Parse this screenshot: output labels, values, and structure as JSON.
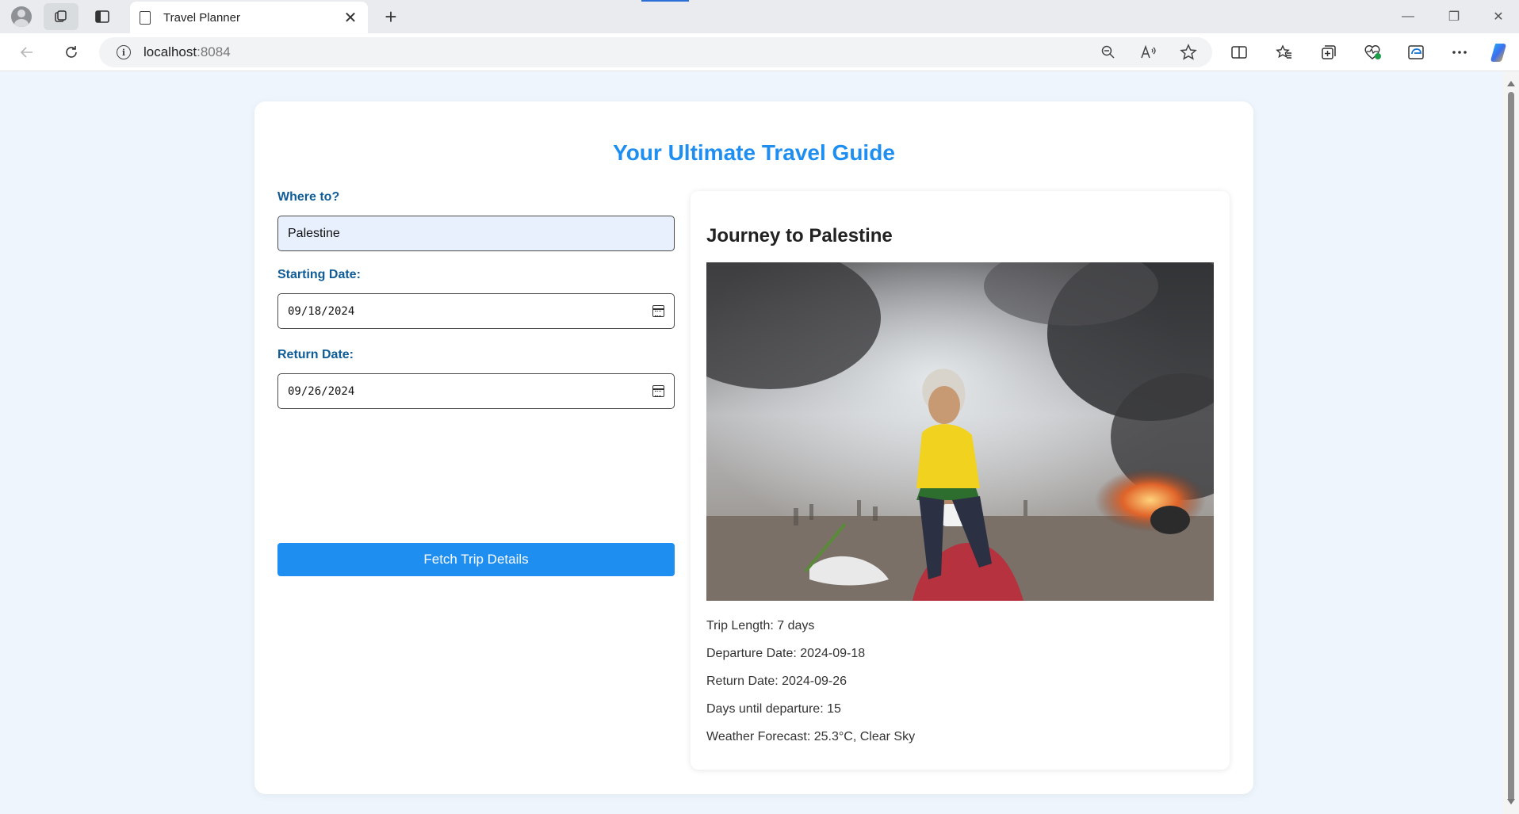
{
  "browser": {
    "tab_title": "Travel Planner",
    "tab_close": "✕",
    "new_tab": "+",
    "url_host": "localhost",
    "url_port": ":8084",
    "window_controls": {
      "minimize": "—",
      "restore": "❐",
      "close": "✕"
    }
  },
  "page": {
    "heading": "Your Ultimate Travel Guide",
    "form": {
      "destination_label": "Where to?",
      "destination_value": "Palestine",
      "start_label": "Starting Date:",
      "start_value": "09/18/2024",
      "return_label": "Return Date:",
      "return_value": "09/26/2024",
      "button_label": "Fetch Trip Details"
    },
    "result": {
      "title": "Journey to Palestine",
      "trip_length": "Trip Length: 7 days",
      "departure": "Departure Date: 2024-09-18",
      "return": "Return Date: 2024-09-26",
      "days_until": "Days until departure: 15",
      "weather": "Weather Forecast: 25.3°C, Clear Sky"
    }
  },
  "colors": {
    "accent": "#1e8ff1",
    "label": "#0f5c97",
    "background": "#eef5fd"
  }
}
